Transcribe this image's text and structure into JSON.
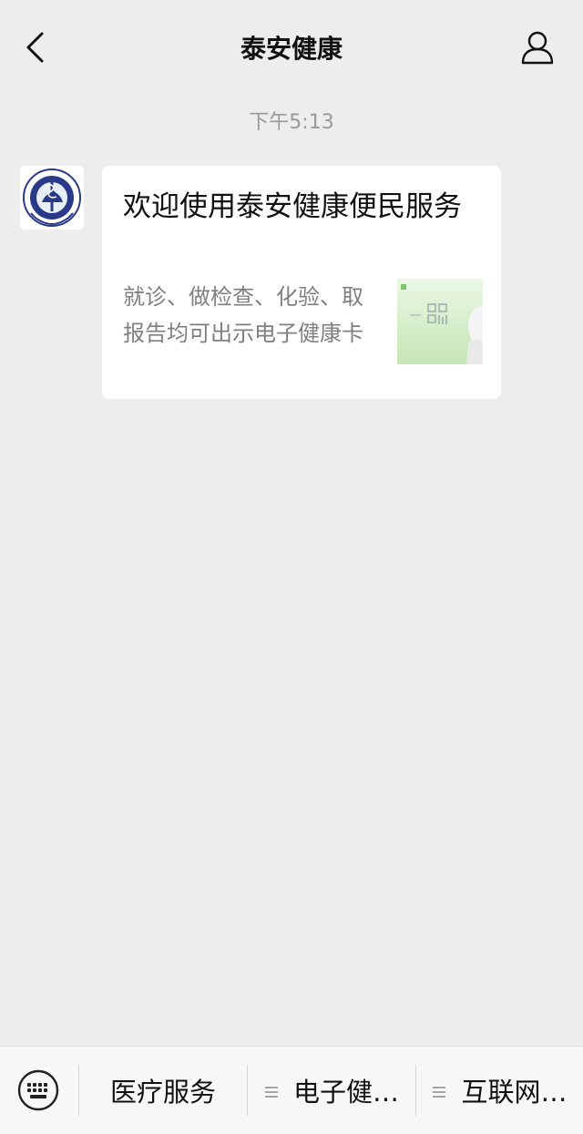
{
  "header": {
    "title": "泰安健康",
    "back_icon": "chevron-left-icon",
    "profile_icon": "person-icon"
  },
  "chat": {
    "timestamp": "下午5:13",
    "message": {
      "title": "欢迎使用泰安健康便民服务",
      "description": "就诊、做检查、化验、取报告均可出示电子健康卡",
      "thumbnail_icon": "health-card-thumbnail"
    }
  },
  "bottom_menu": {
    "keyboard_icon": "keyboard-icon",
    "items": [
      {
        "label": "医疗服务"
      },
      {
        "label": "电子健…",
        "icon": "menu-list-icon"
      },
      {
        "label": "互联网…",
        "icon": "menu-list-icon"
      }
    ]
  }
}
